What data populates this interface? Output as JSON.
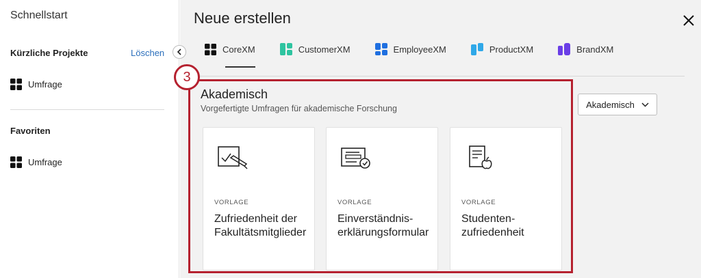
{
  "sidebar": {
    "title": "Schnellstart",
    "recent": {
      "heading": "Kürzliche Projekte",
      "clear": "Löschen",
      "items": [
        {
          "label": "Umfrage",
          "icon": "corexm-icon"
        }
      ]
    },
    "favorites": {
      "heading": "Favoriten",
      "items": [
        {
          "label": "Umfrage",
          "icon": "corexm-icon"
        }
      ]
    }
  },
  "main": {
    "title": "Neue erstellen",
    "tabs": [
      {
        "label": "CoreXM",
        "icon": "corexm-icon",
        "color": "#000000",
        "active": true
      },
      {
        "label": "CustomerXM",
        "icon": "customerxm-icon",
        "color": "#2ec4a0"
      },
      {
        "label": "EmployeeXM",
        "icon": "employeexm-icon",
        "color": "#1f6fe0"
      },
      {
        "label": "ProductXM",
        "icon": "productxm-icon",
        "color": "#2fa8e8"
      },
      {
        "label": "BrandXM",
        "icon": "brandxm-icon",
        "color": "#6a3ee6"
      }
    ],
    "category": {
      "title": "Akademisch",
      "subtitle": "Vorgefertigte Umfragen für akademische Forschung"
    },
    "dropdown": {
      "selected": "Akademisch"
    },
    "cards": [
      {
        "kicker": "VORLAGE",
        "title": "Zufriedenheit der Fakultätsmitglieder",
        "icon": "pen-chart-icon"
      },
      {
        "kicker": "VORLAGE",
        "title": "Einverständnis-erklärungsformular",
        "icon": "form-check-icon"
      },
      {
        "kicker": "VORLAGE",
        "title": "Studenten-zufriedenheit",
        "icon": "document-apple-icon"
      }
    ]
  },
  "annotation": {
    "step": "3",
    "color": "#b5212f"
  }
}
